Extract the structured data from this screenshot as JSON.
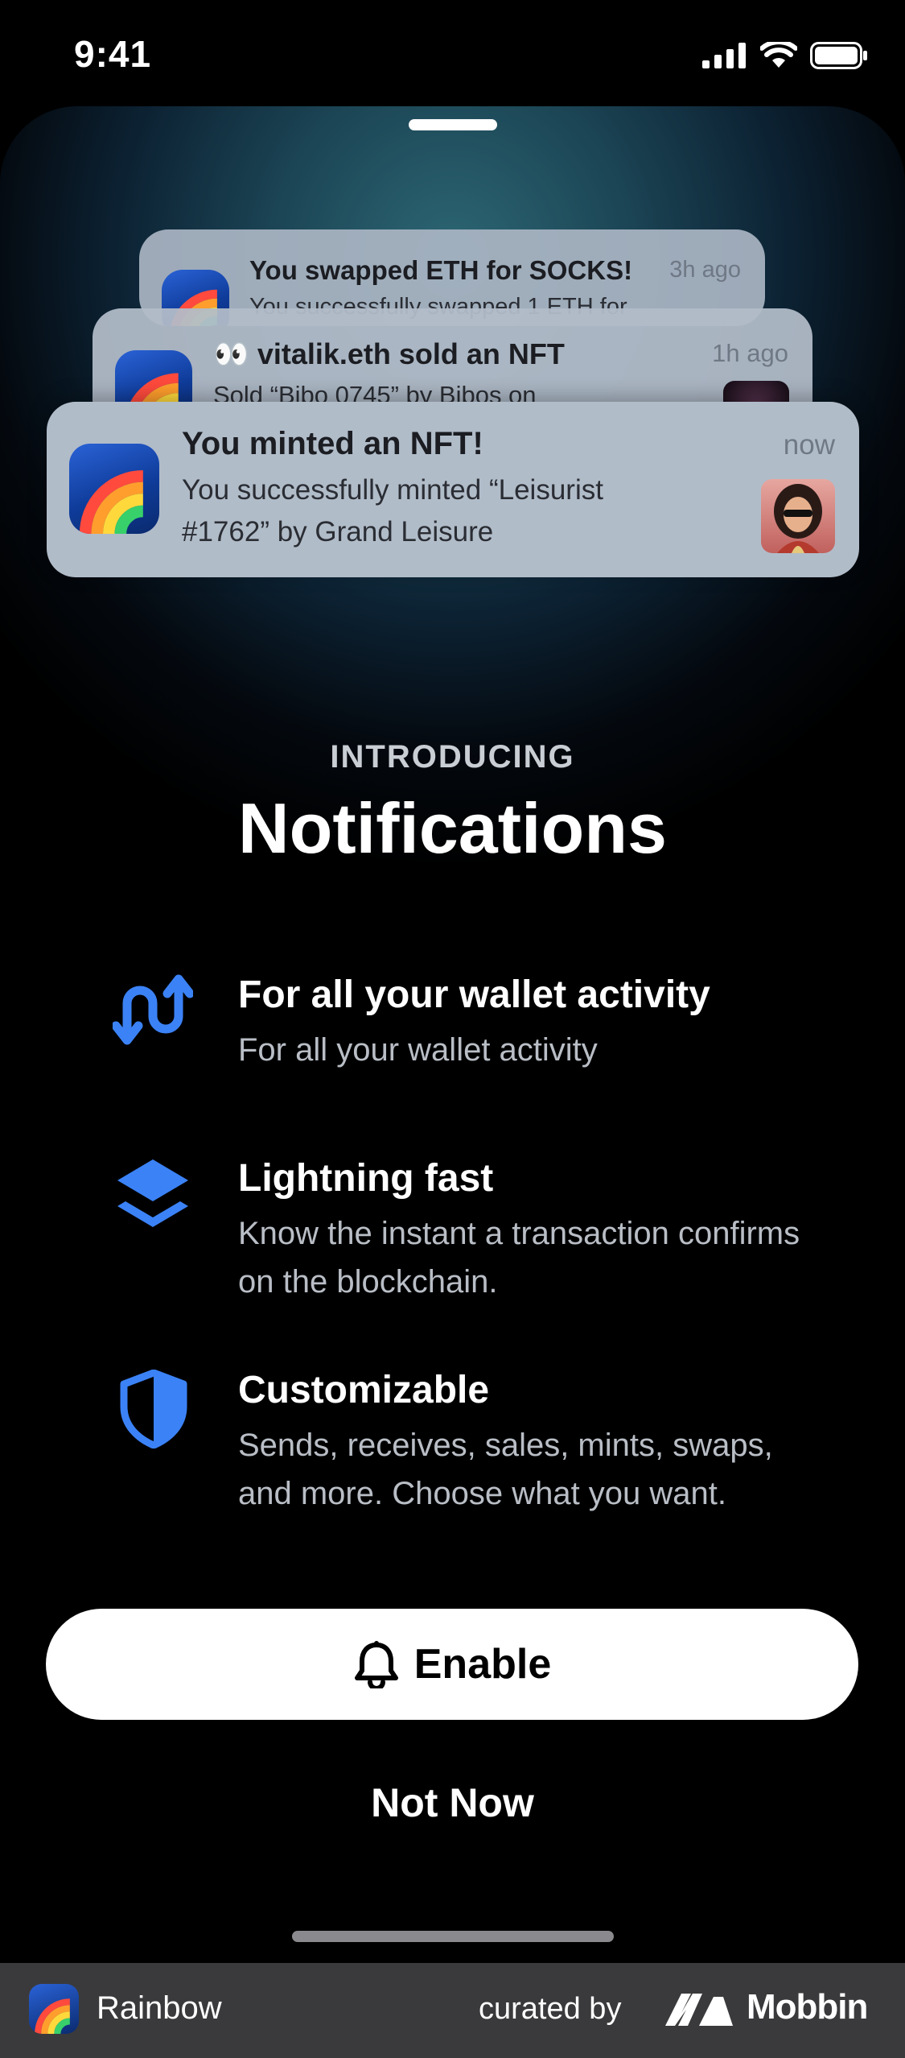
{
  "status_bar": {
    "time": "9:41"
  },
  "notifications": [
    {
      "title": "You swapped ETH for SOCKS!",
      "body_line1": "You successfully swapped 1 ETH for",
      "time": "3h ago"
    },
    {
      "emoji": "👀",
      "title": "vitalik.eth sold an NFT",
      "body_line1": "Sold “Bibo 0745” by Bibos on",
      "time": "1h ago"
    },
    {
      "title": "You minted an NFT!",
      "body_line1": "You successfully minted “Leisurist",
      "body_line2": "#1762” by Grand Leisure",
      "time": "now"
    }
  ],
  "intro": {
    "eyebrow": "INTRODUCING",
    "headline": "Notifications"
  },
  "features": [
    {
      "icon": "arrows-swap-icon",
      "title": "For all your wallet activity",
      "desc": "For all your wallet activity"
    },
    {
      "icon": "layers-icon",
      "title": "Lightning fast",
      "desc": "Know the instant a transaction confirms on the blockchain."
    },
    {
      "icon": "shield-icon",
      "title": "Customizable",
      "desc": "Sends, receives, sales, mints, swaps, and more. Choose what you want."
    }
  ],
  "buttons": {
    "enable": "Enable",
    "not_now": "Not Now"
  },
  "footer": {
    "app_name": "Rainbow",
    "curated_by": "curated by",
    "brand": "Mobbin"
  },
  "colors": {
    "accent_blue": "#3b82f6",
    "background": "#000000",
    "button_bg": "#ffffff"
  }
}
